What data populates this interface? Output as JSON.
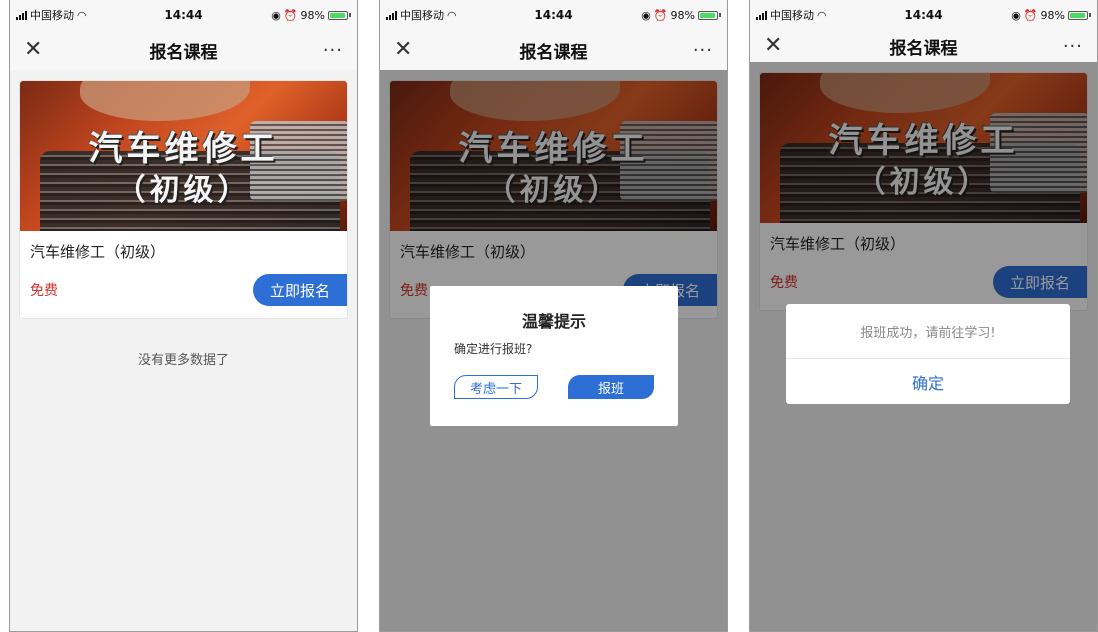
{
  "status_bar": {
    "carrier": "中国移动",
    "time": "14:44",
    "battery": "98%",
    "battery_level": 0.98
  },
  "nav": {
    "close_icon": "close-icon",
    "title": "报名课程",
    "more_icon": "more-icon"
  },
  "course": {
    "banner_title": "汽车维修工",
    "banner_sub": "（初级）",
    "name": "汽车维修工（初级）",
    "price": "免费",
    "enroll_label": "立即报名"
  },
  "list": {
    "end_text": "没有更多数据了"
  },
  "confirm_dialog": {
    "title": "温馨提示",
    "message": "确定进行报班?",
    "cancel_label": "考虑一下",
    "confirm_label": "报班"
  },
  "success_dialog": {
    "message": "报班成功，请前往学习!",
    "ok_label": "确定"
  },
  "colors": {
    "accent": "#2d6fd4",
    "price": "#d0342c",
    "battery": "#4cd964"
  }
}
